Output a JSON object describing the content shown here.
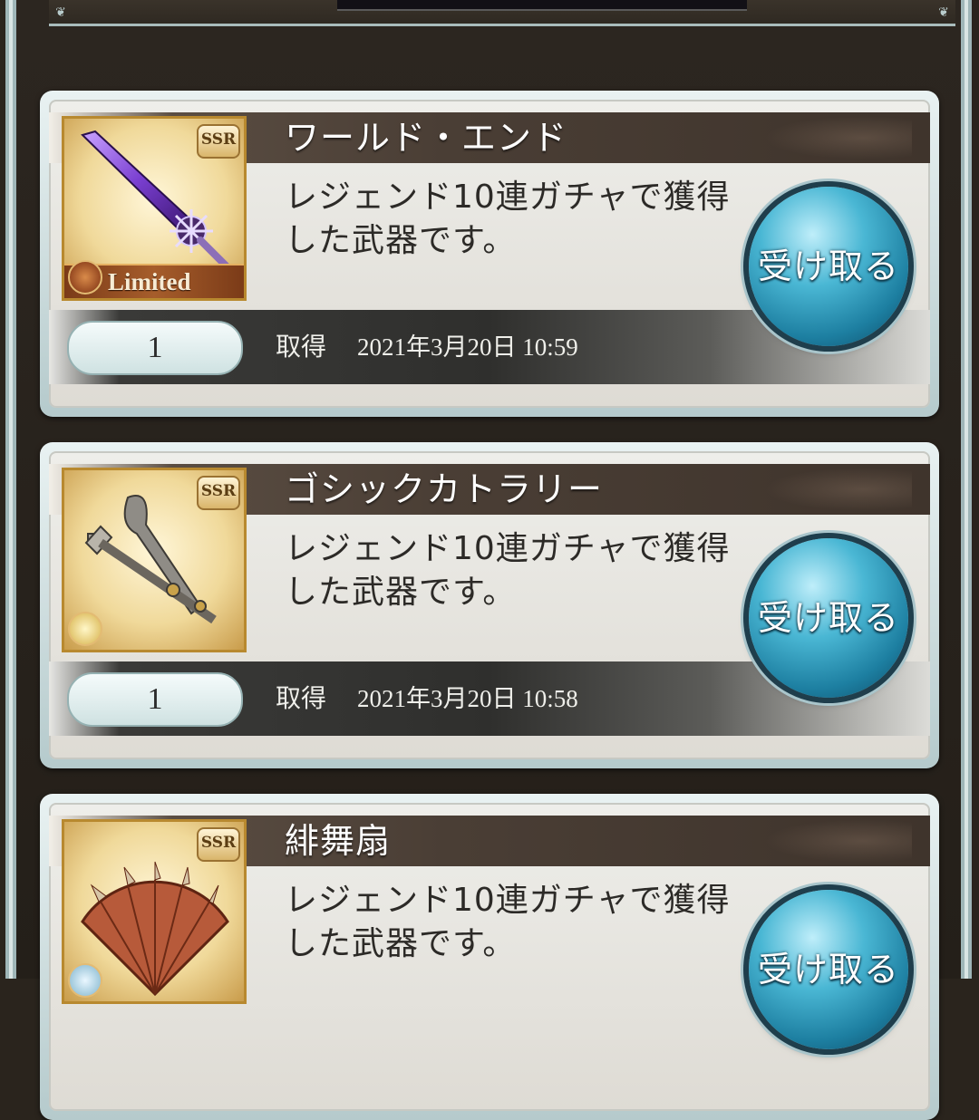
{
  "items": [
    {
      "name": "ワールド・エンド",
      "description": "レジェンド10連ガチャで獲得した武器です。",
      "rarity": "SSR",
      "badge": "Limited",
      "element": "fire",
      "quantity": "1",
      "acquired_label": "取得",
      "acquired_date": "2021年3月20日 10:59",
      "receive_label": "受け取る",
      "weapon_icon": "sword-icon"
    },
    {
      "name": "ゴシックカトラリー",
      "description": "レジェンド10連ガチャで獲得した武器です。",
      "rarity": "SSR",
      "element": "light",
      "quantity": "1",
      "acquired_label": "取得",
      "acquired_date": "2021年3月20日 10:58",
      "receive_label": "受け取る",
      "weapon_icon": "cutlery-icon"
    },
    {
      "name": "緋舞扇",
      "description": "レジェンド10連ガチャで獲得した武器です。",
      "rarity": "SSR",
      "element": "wind",
      "receive_label": "受け取る",
      "weapon_icon": "fan-icon"
    }
  ]
}
